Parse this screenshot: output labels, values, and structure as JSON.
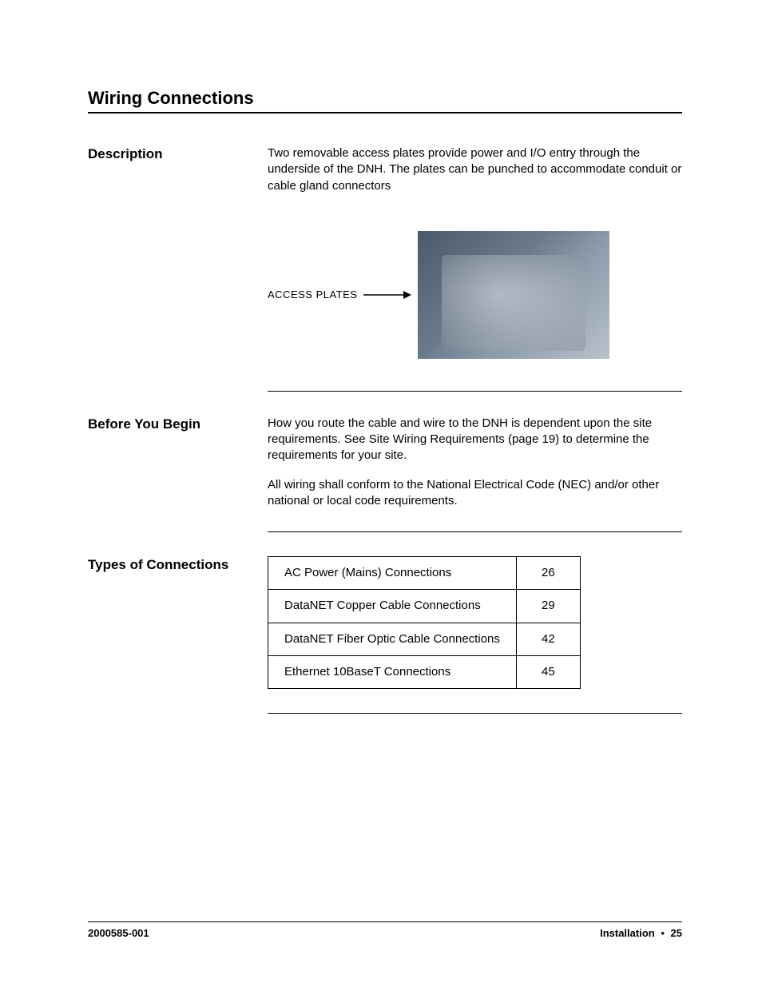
{
  "section_title": "Wiring Connections",
  "description": {
    "heading": "Description",
    "paragraph": "Two removable access plates provide power and I/O entry through the underside of the DNH. The plates can be punched to accommodate conduit or cable gland connectors",
    "figure_label": "ACCESS PLATES"
  },
  "before_you_begin": {
    "heading": "Before You Begin",
    "para1": "How you route the cable and wire to the DNH is dependent upon the site requirements. See Site Wiring Requirements (page 19) to determine the requirements for your site.",
    "para2": "All wiring shall conform to the National Electrical Code (NEC) and/or other national or local code requirements."
  },
  "types_of_connections": {
    "heading": "Types of Connections",
    "rows": [
      {
        "label": "AC Power (Mains) Connections",
        "page": "26"
      },
      {
        "label": "DataNET Copper Cable Connections",
        "page": "29"
      },
      {
        "label": "DataNET Fiber Optic Cable Connections",
        "page": "42"
      },
      {
        "label": "Ethernet 10BaseT Connections",
        "page": "45"
      }
    ]
  },
  "footer": {
    "doc_number": "2000585-001",
    "section": "Installation",
    "bullet": "•",
    "page": "25"
  }
}
